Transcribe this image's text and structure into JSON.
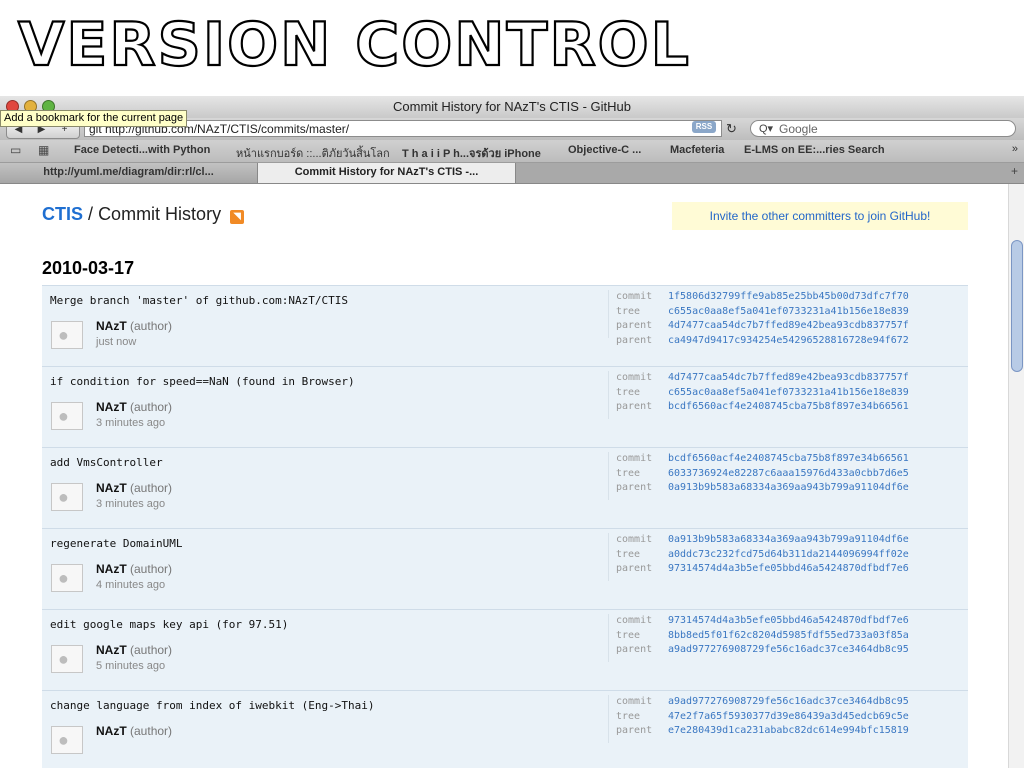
{
  "slide": {
    "title": "VERSION CONTROL"
  },
  "window": {
    "title": "Commit History for NAzT's CTIS - GitHub",
    "tooltip": "Add a bookmark for the current page",
    "url": "git http://github.com/NAzT/CTIS/commits/master/",
    "rss_label": "RSS",
    "search_placeholder": "Google",
    "bookmarks": [
      "Face Detecti...with Python",
      "หน้าแรกบอร์ด ::...ติภัยวันสิ้นโลก",
      "T h a i i P h...จรด้วย iPhone",
      "Objective-C ...",
      "Macfeteria",
      "E-LMS on EE:...ries Search"
    ],
    "tabs": [
      "http://yuml.me/diagram/dir:rl/cl...",
      "Commit History for NAzT's CTIS -..."
    ]
  },
  "page": {
    "repo": "CTIS",
    "separator": "/",
    "section": "Commit History",
    "invite": "Invite the other committers to join GitHub!",
    "date": "2010-03-17"
  },
  "commits": [
    {
      "message": "Merge branch 'master' of github.com:NAzT/CTIS",
      "author": "NAzT",
      "role": "(author)",
      "time": "just now",
      "meta": [
        {
          "label": "commit",
          "hash": "1f5806d32799ffe9ab85e25bb45b00d73dfc7f70"
        },
        {
          "label": "tree",
          "hash": "c655ac0aa8ef5a041ef0733231a41b156e18e839"
        },
        {
          "label": "parent",
          "hash": "4d7477caa54dc7b7ffed89e42bea93cdb837757f"
        },
        {
          "label": "parent",
          "hash": "ca4947d9417c934254e54296528816728e94f672"
        }
      ]
    },
    {
      "message": "if condition for speed==NaN (found in Browser)",
      "author": "NAzT",
      "role": "(author)",
      "time": "3 minutes ago",
      "meta": [
        {
          "label": "commit",
          "hash": "4d7477caa54dc7b7ffed89e42bea93cdb837757f"
        },
        {
          "label": "tree",
          "hash": "c655ac0aa8ef5a041ef0733231a41b156e18e839"
        },
        {
          "label": "parent",
          "hash": "bcdf6560acf4e2408745cba75b8f897e34b66561"
        }
      ]
    },
    {
      "message": "add VmsController",
      "author": "NAzT",
      "role": "(author)",
      "time": "3 minutes ago",
      "meta": [
        {
          "label": "commit",
          "hash": "bcdf6560acf4e2408745cba75b8f897e34b66561"
        },
        {
          "label": "tree",
          "hash": "6033736924e82287c6aaa15976d433a0cbb7d6e5"
        },
        {
          "label": "parent",
          "hash": "0a913b9b583a68334a369aa943b799a91104df6e"
        }
      ]
    },
    {
      "message": "regenerate DomainUML",
      "author": "NAzT",
      "role": "(author)",
      "time": "4 minutes ago",
      "meta": [
        {
          "label": "commit",
          "hash": "0a913b9b583a68334a369aa943b799a91104df6e"
        },
        {
          "label": "tree",
          "hash": "a0ddc73c232fcd75d64b311da2144096994ff02e"
        },
        {
          "label": "parent",
          "hash": "97314574d4a3b5efe05bbd46a5424870dfbdf7e6"
        }
      ]
    },
    {
      "message": "edit google maps key api (for 97.51)",
      "author": "NAzT",
      "role": "(author)",
      "time": "5 minutes ago",
      "meta": [
        {
          "label": "commit",
          "hash": "97314574d4a3b5efe05bbd46a5424870dfbdf7e6"
        },
        {
          "label": "tree",
          "hash": "8bb8ed5f01f62c8204d5985fdf55ed733a03f85a"
        },
        {
          "label": "parent",
          "hash": "a9ad977276908729fe56c16adc37ce3464db8c95"
        }
      ]
    },
    {
      "message": "change language from index of iwebkit (Eng->Thai)",
      "author": "NAzT",
      "role": "(author)",
      "time": "",
      "meta": [
        {
          "label": "commit",
          "hash": "a9ad977276908729fe56c16adc37ce3464db8c95"
        },
        {
          "label": "tree",
          "hash": "47e2f7a65f5930377d39e86439a3d45edcb69c5e"
        },
        {
          "label": "parent",
          "hash": "e7e280439d1ca231ababc82dc614e994bfc15819"
        }
      ]
    }
  ]
}
